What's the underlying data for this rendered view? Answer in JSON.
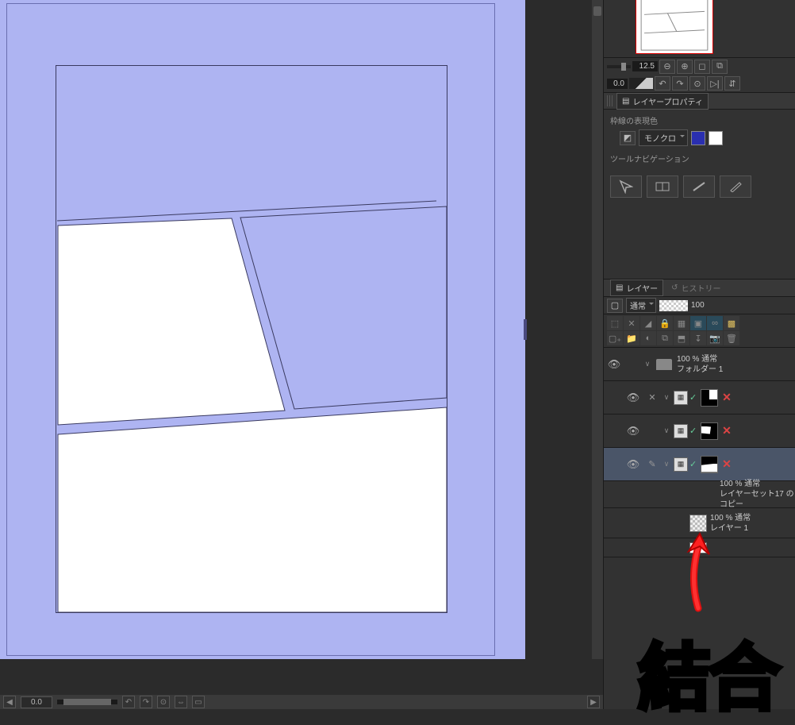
{
  "canvas": {
    "zoom_display": "0.0"
  },
  "navigator": {
    "zoom": "12.5",
    "rotation": "0.0"
  },
  "layer_property": {
    "panel_title": "レイヤープロパティ",
    "section_border_color": "枠線の表現色",
    "color_mode": "モノクロ",
    "section_tool_nav": "ツールナビゲーション"
  },
  "layer_panel": {
    "tab_layer": "レイヤー",
    "tab_history": "ヒストリー",
    "blend_mode": "通常",
    "opacity": "100"
  },
  "layers": [
    {
      "opacity_mode": "100 % 通常",
      "name": "フォルダー 1"
    },
    {
      "opacity_mode": "",
      "name": ""
    },
    {
      "opacity_mode": "",
      "name": ""
    },
    {
      "opacity_mode": "",
      "name": ""
    },
    {
      "opacity_mode": "100 % 通常",
      "name": "レイヤーセット17 のコピー"
    },
    {
      "opacity_mode": "100 % 通常",
      "name": "レイヤー 1"
    }
  ],
  "annotation": {
    "text": "結合"
  }
}
